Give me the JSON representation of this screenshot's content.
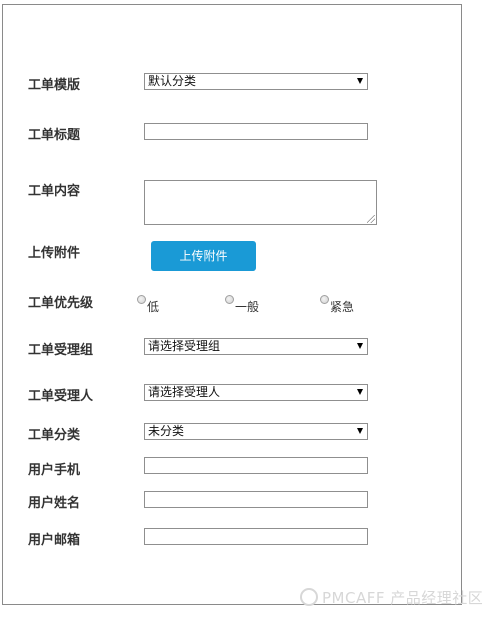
{
  "form": {
    "template": {
      "label": "工单模版",
      "value": "默认分类"
    },
    "title": {
      "label": "工单标题",
      "value": ""
    },
    "content": {
      "label": "工单内容",
      "value": ""
    },
    "attachment": {
      "label": "上传附件",
      "button_label": "上传附件"
    },
    "priority": {
      "label": "工单优先级",
      "options": [
        "低",
        "一般",
        "紧急"
      ]
    },
    "handler_group": {
      "label": "工单受理组",
      "value": "请选择受理组"
    },
    "handler": {
      "label": "工单受理人",
      "value": "请选择受理人"
    },
    "category": {
      "label": "工单分类",
      "value": "未分类"
    },
    "user_phone": {
      "label": "用户手机",
      "value": ""
    },
    "user_name": {
      "label": "用户姓名",
      "value": ""
    },
    "user_email": {
      "label": "用户邮箱",
      "value": ""
    }
  },
  "watermark": {
    "text": "PMCAFF 产品经理社区"
  },
  "colors": {
    "primary_button": "#1a9ad6",
    "border": "#8f8f8f",
    "frame": "#8a8a8a"
  }
}
